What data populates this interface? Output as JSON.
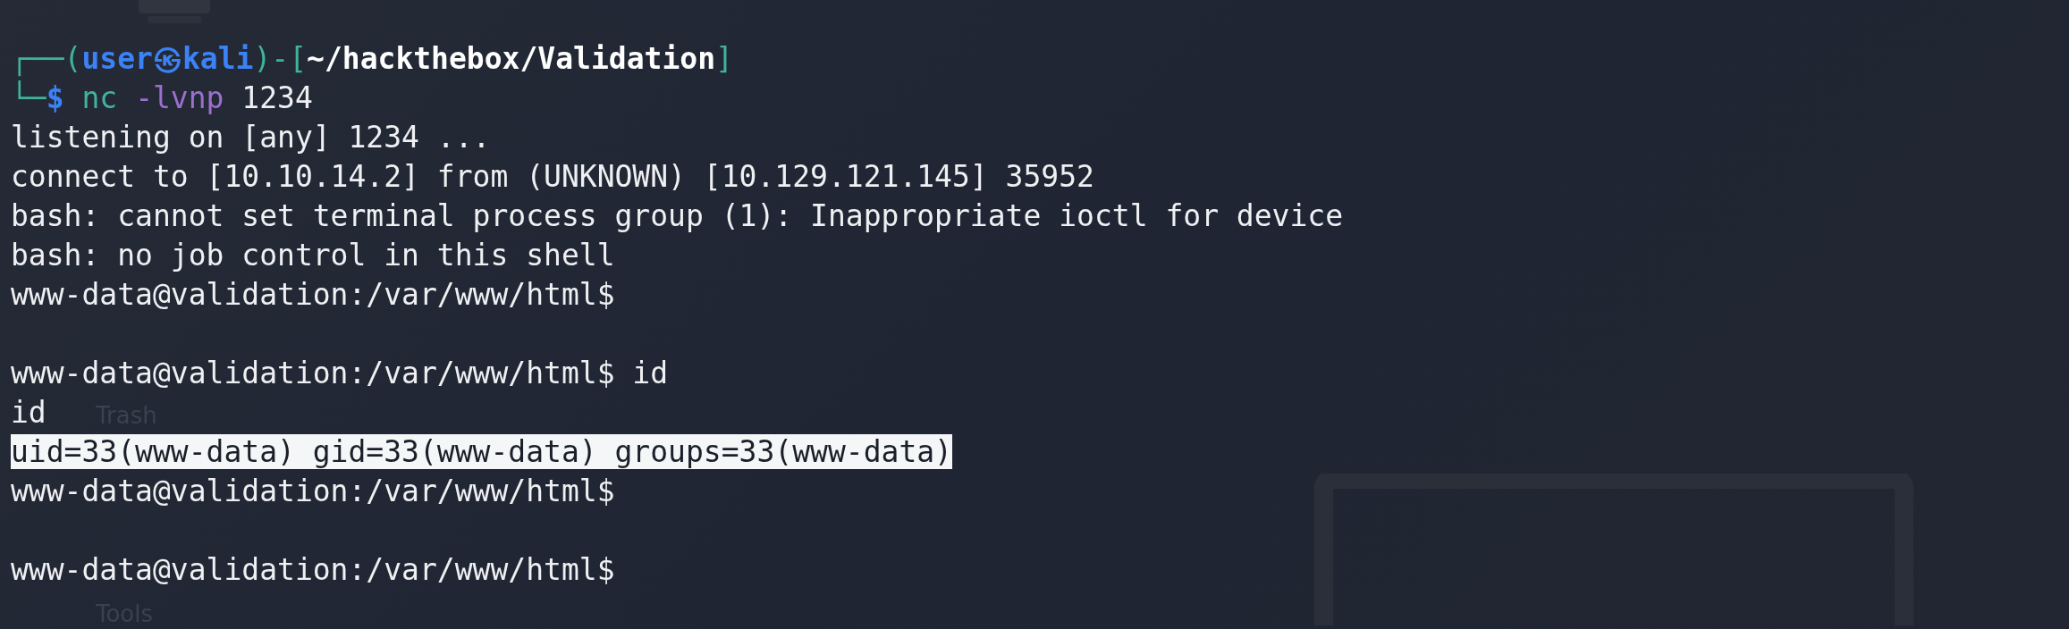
{
  "desktop": {
    "icons": [
      {
        "kind": "computer"
      },
      {
        "kind": "label",
        "label": "Trash"
      },
      {
        "kind": "label",
        "label": "Tools"
      }
    ]
  },
  "terminal": {
    "lines": [
      {
        "kind": "prompt_head",
        "open": "┌──(",
        "user": "user㉿kali",
        "mid": ")-[",
        "path": "~/hackthebox/Validation",
        "close": "]"
      },
      {
        "kind": "prompt_cmd",
        "corner": "└─",
        "sigil": "$",
        "command": "nc",
        "flag": "-lvnp",
        "arg": "1234"
      },
      {
        "kind": "output",
        "text": "listening on [any] 1234 ...",
        "selected": false
      },
      {
        "kind": "output",
        "text": "connect to [10.10.14.2] from (UNKNOWN) [10.129.121.145] 35952",
        "selected": false
      },
      {
        "kind": "output",
        "text": "bash: cannot set terminal process group (1): Inappropriate ioctl for device",
        "selected": false
      },
      {
        "kind": "output",
        "text": "bash: no job control in this shell",
        "selected": false
      },
      {
        "kind": "output",
        "text": "www-data@validation:/var/www/html$",
        "selected": false
      },
      {
        "kind": "blank"
      },
      {
        "kind": "output",
        "text": "www-data@validation:/var/www/html$ id",
        "selected": false
      },
      {
        "kind": "output",
        "text": "id",
        "selected": false
      },
      {
        "kind": "output",
        "text": "uid=33(www-data) gid=33(www-data) groups=33(www-data)",
        "selected": true
      },
      {
        "kind": "output",
        "text": "www-data@validation:/var/www/html$",
        "selected": false
      },
      {
        "kind": "blank"
      },
      {
        "kind": "output",
        "text": "www-data@validation:/var/www/html$",
        "selected": false
      }
    ]
  }
}
